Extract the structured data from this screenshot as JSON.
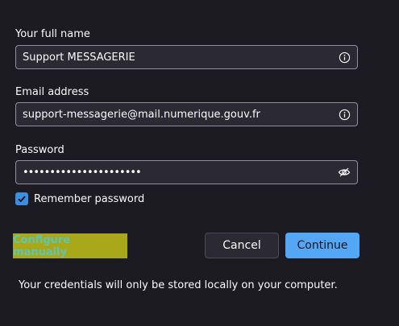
{
  "form": {
    "name": {
      "label": "Your full name",
      "value": "Support MESSAGERIE"
    },
    "email": {
      "label": "Email address",
      "value": "support-messagerie@mail.numerique.gouv.fr"
    },
    "password": {
      "label": "Password",
      "value": "••••••••••••••••••••••"
    },
    "remember": {
      "label": "Remember password",
      "checked": true
    }
  },
  "actions": {
    "configure_label": "Configure manually",
    "cancel_label": "Cancel",
    "continue_label": "Continue"
  },
  "footer": {
    "note": "Your credentials will only be stored locally on your computer."
  },
  "colors": {
    "background": "#1c1b22",
    "input_bg": "#2b2a33",
    "accent": "#54a7f5",
    "highlight": "#a8a81a"
  },
  "icons": {
    "name": "info-icon",
    "email": "info-icon",
    "password": "eye-slash-icon",
    "checkbox": "checkmark-icon"
  }
}
